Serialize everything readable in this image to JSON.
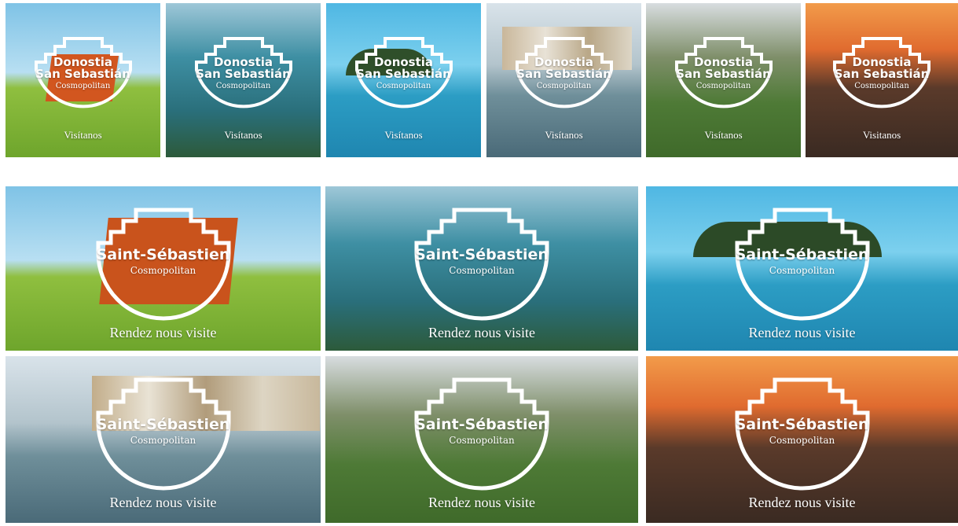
{
  "small_tiles": [
    {
      "city_line1": "Donostia",
      "city_line2": "San Sebastián",
      "tagline": "Cosmopolitan",
      "cta": "Visítanos"
    },
    {
      "city_line1": "Donostia",
      "city_line2": "San Sebastián",
      "tagline": "Cosmopolitan",
      "cta": "Visítanos"
    },
    {
      "city_line1": "Donostia",
      "city_line2": "San Sebastián",
      "tagline": "Cosmopolitan",
      "cta": "Visítanos"
    },
    {
      "city_line1": "Donostia",
      "city_line2": "San Sebastián",
      "tagline": "Cosmopolitan",
      "cta": "Visítanos"
    },
    {
      "city_line1": "Donostia",
      "city_line2": "San Sebastián",
      "tagline": "Cosmopolitan",
      "cta": "Visítanos"
    },
    {
      "city_line1": "Donostia",
      "city_line2": "San Sebastián",
      "tagline": "Cosmopolitan",
      "cta": "Visitanos"
    }
  ],
  "large_tiles": [
    {
      "city": "Saint-Sébastien",
      "tagline": "Cosmopolitan",
      "cta": "Rendez nous visite"
    },
    {
      "city": "Saint-Sébastien",
      "tagline": "Cosmopolitan",
      "cta": "Rendez nous visite"
    },
    {
      "city": "Saint-Sébastien",
      "tagline": "Cosmopolitan",
      "cta": "Rendez nous visite"
    },
    {
      "city": "Saint-Sébastien",
      "tagline": "Cosmopolitan",
      "cta": "Rendez nous visite"
    },
    {
      "city": "Saint-Sébastien",
      "tagline": "Cosmopolitan",
      "cta": "Rendez nous visite"
    },
    {
      "city": "Saint-Sébastien",
      "tagline": "Cosmopolitan",
      "cta": "Rendez nous visite"
    }
  ],
  "badge": {
    "color": "#ffffff",
    "icon": "stepped-shell-outline-icon"
  }
}
